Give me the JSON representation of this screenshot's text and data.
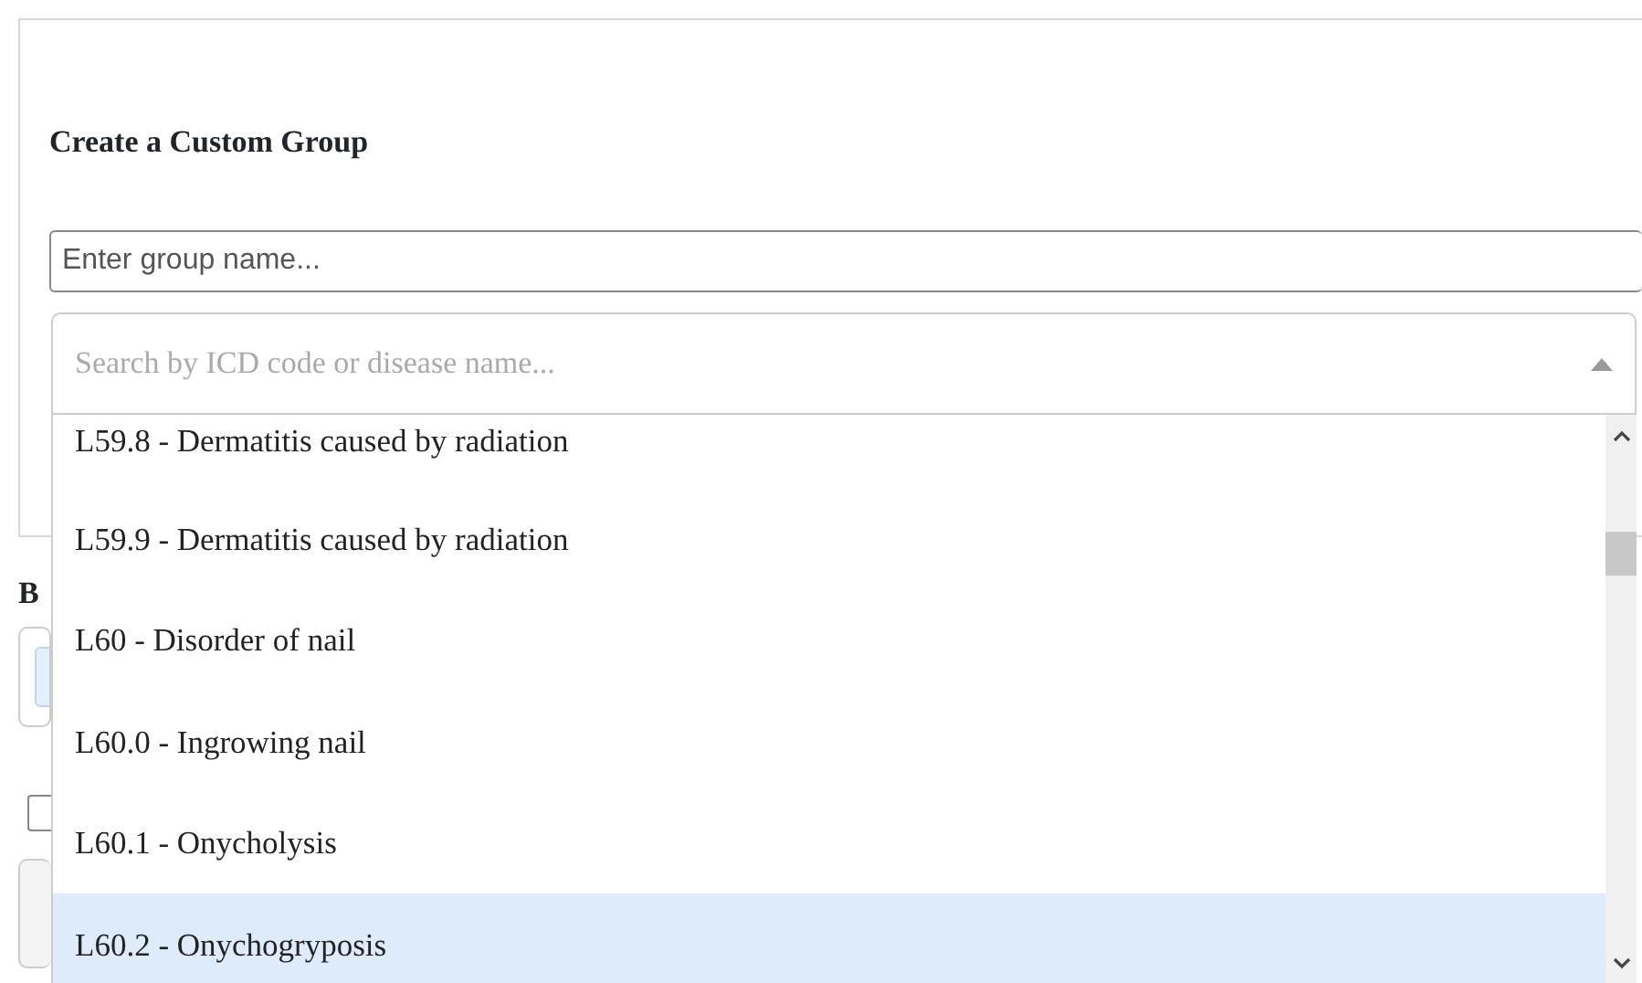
{
  "heading": "Create a Custom Group",
  "group_name": {
    "placeholder": "Enter group name..."
  },
  "search": {
    "placeholder": "Search by ICD code or disease name..."
  },
  "options": [
    {
      "label": "L59.8 - Dermatitis caused by radiation",
      "selected": false
    },
    {
      "label": "L59.9 - Dermatitis caused by radiation",
      "selected": false
    },
    {
      "label": "L60 - Disorder of nail",
      "selected": false
    },
    {
      "label": "L60.0 - Ingrowing nail",
      "selected": false
    },
    {
      "label": "L60.1 - Onycholysis",
      "selected": false
    },
    {
      "label": "L60.2 - Onychogryposis",
      "selected": true
    }
  ],
  "background_label": "B",
  "background_checkbox": {
    "checked": false
  }
}
